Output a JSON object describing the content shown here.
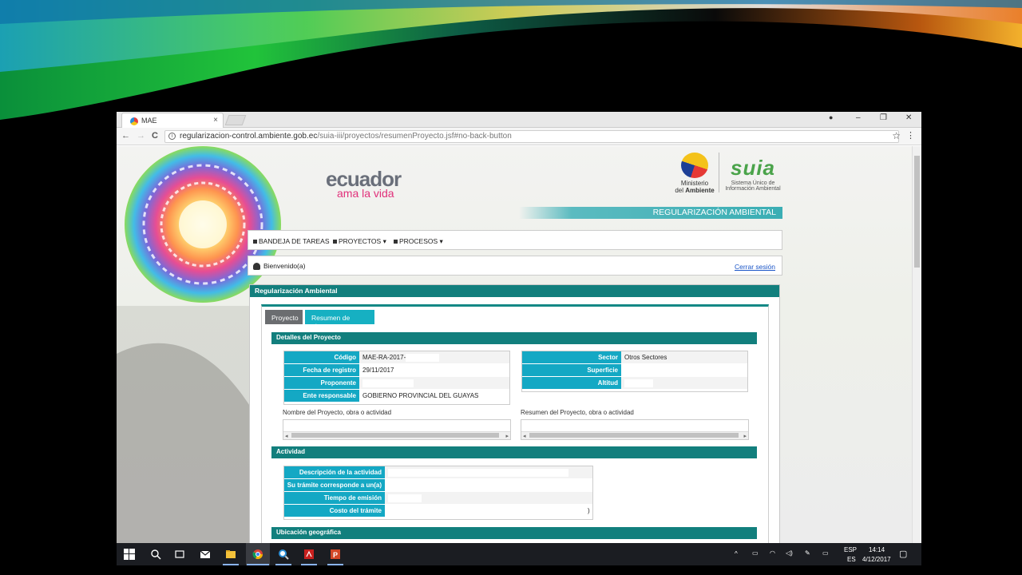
{
  "browser": {
    "tab_title": "MAE",
    "tab_close": "×",
    "url_host": "regularizacion-control.ambiente.gob.ec",
    "url_path": "/suia-iii/proyectos/resumenProyecto.jsf#no-back-button",
    "window_minimize": "–",
    "window_restore": "❐",
    "window_close": "✕",
    "back_icon": "←",
    "forward_icon": "→",
    "reload_icon": "C",
    "star_icon": "☆",
    "menu_icon": "⋮"
  },
  "header": {
    "ecuador_line1": "ecuador",
    "ecuador_line2": "ama la vida",
    "ministerio_line1": "Ministerio",
    "ministerio_line2": "del",
    "ministerio_line3": "Ambiente",
    "suia_mark": "suia",
    "suia_line1": "Sistema Único de",
    "suia_line2": "Información Ambiental",
    "banner": "REGULARIZACIÓN AMBIENTAL"
  },
  "menu": {
    "items": [
      "BANDEJA DE TAREAS",
      "PROYECTOS ▾",
      "PROCESOS ▾"
    ]
  },
  "welcome": {
    "greeting": "Bienvenido(a)",
    "logout": "Cerrar sesión"
  },
  "panel": {
    "title": "Regularización Ambiental",
    "tabs": [
      "Proyecto",
      "Resumen de etapas"
    ],
    "details_title": "Detalles del Proyecto",
    "left_fields": [
      {
        "label": "Código",
        "value": "MAE-RA-2017-"
      },
      {
        "label": "Fecha de registro",
        "value": "29/11/2017"
      },
      {
        "label": "Proponente",
        "value": ""
      },
      {
        "label": "Ente responsable",
        "value": "GOBIERNO PROVINCIAL DEL GUAYAS"
      }
    ],
    "right_fields": [
      {
        "label": "Sector",
        "value": "Otros Sectores"
      },
      {
        "label": "Superficie",
        "value": ""
      },
      {
        "label": "Altitud",
        "value": ""
      }
    ],
    "name_label": "Nombre del Proyecto, obra o actividad",
    "summary_label": "Resumen del Proyecto, obra o actividad",
    "activity_title": "Actividad",
    "activity_fields": [
      {
        "label": "Descripción de la actividad",
        "value": ""
      },
      {
        "label": "Su trámite corresponde a un(a)",
        "value": ""
      },
      {
        "label": "Tiempo de emisión",
        "value": ""
      },
      {
        "label": "Costo del trámite",
        "value": ")"
      }
    ],
    "location_title": "Ubicación geográfica"
  },
  "taskbar": {
    "lang_top": "ESP",
    "lang_bottom": "ES",
    "time": "14:14",
    "date": "4/12/2017"
  }
}
